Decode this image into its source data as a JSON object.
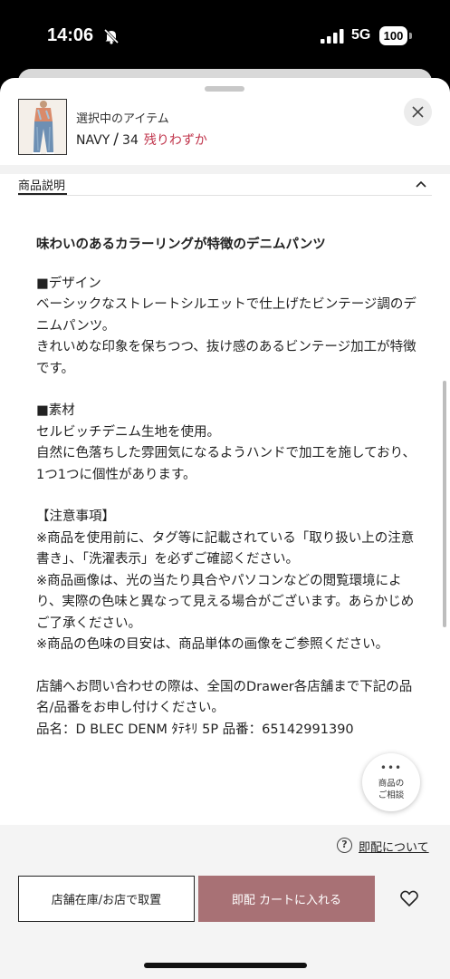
{
  "status_bar": {
    "time": "14:06",
    "network": "5G",
    "battery": "100"
  },
  "selected_item": {
    "label": "選択中のアイテム",
    "color": "NAVY",
    "separator": "/",
    "size": "34",
    "stock_status": "残りわずか"
  },
  "section": {
    "tab_label": "商品説明"
  },
  "description": {
    "title": "味わいのあるカラーリングが特徴のデニムパンツ",
    "body": "■デザイン\nベーシックなストレートシルエットで仕上げたビンテージ調のデニムパンツ。\nきれいめな印象を保ちつつ、抜け感のあるビンテージ加工が特徴です。\n\n■素材\nセルビッチデニム生地を使用。\n自然に色落ちした雰囲気になるようハンドで加工を施しており、1つ1つに個性があります。\n\n【注意事項】\n※商品を使用前に、タグ等に記載されている「取り扱い上の注意書き」、「洗濯表示」を必ずご確認ください。\n※商品画像は、光の当たり具合やパソコンなどの閲覧環境により、実際の色味と異なって見える場合がございます。あらかじめご了承ください。\n※商品の色味の目安は、商品単体の画像をご参照ください。\n\n店舗へお問い合わせの際は、全国のDrawer各店舗まで下記の品名/品番をお申し付けください。\n品名：D BLEC DENM ﾀﾃｷﾘ 5P 品番：65142991390"
  },
  "consult_button": {
    "dots": "•••",
    "label_line1": "商品の",
    "label_line2": "ご相談"
  },
  "footer": {
    "help_icon": "?",
    "help_link": "即配について",
    "store_button": "店舗在庫/お店で取置",
    "cart_button": "即配 カートに入れる"
  },
  "icons": {
    "mute": "bell-slash-icon",
    "signal": "signal-icon",
    "close": "close-icon",
    "collapse": "chevron-up-icon",
    "favorite": "heart-icon"
  },
  "colors": {
    "accent": "#a87175",
    "low_stock": "#c0344b"
  }
}
